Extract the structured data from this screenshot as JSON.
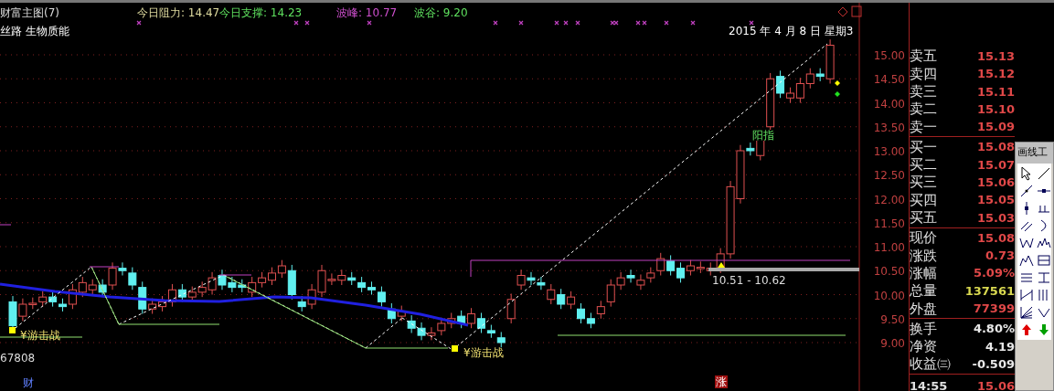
{
  "chart": {
    "title": "财富主图(7)",
    "concepts": "丝路 生物质能",
    "date": "2015 年 4 月 8 日 星期3",
    "indicators": [
      {
        "label": "今日阻力: 14.47",
        "color": "#e0dca0"
      },
      {
        "label": "今日支撑: 14.23",
        "color": "#5ee05e"
      },
      {
        "label": "波峰: 10.77",
        "color": "#d050d0"
      },
      {
        "label": "波谷: 9.20",
        "color": "#5ee05e"
      }
    ],
    "annotations": [
      {
        "kind": "signal",
        "text": "¥游击战"
      },
      {
        "kind": "signal",
        "text": "¥游击战"
      },
      {
        "kind": "pattern",
        "text": "阳指"
      },
      {
        "kind": "range",
        "text": "10.51 - 10.62"
      },
      {
        "kind": "volume",
        "text": "67808"
      },
      {
        "kind": "tag",
        "text": "财"
      },
      {
        "kind": "flag",
        "text": "涨"
      }
    ],
    "y_axis_labels": [
      "15.00",
      "14.50",
      "14.00",
      "13.50",
      "13.00",
      "12.50",
      "12.00",
      "11.50",
      "11.00",
      "10.50",
      "10.00",
      "9.50",
      "9.00"
    ]
  },
  "quotes": [
    [
      {
        "label": "卖五",
        "value": "15.13",
        "kind": "price"
      },
      {
        "label": "卖四",
        "value": "15.12",
        "kind": "price"
      },
      {
        "label": "卖三",
        "value": "15.11",
        "kind": "price"
      },
      {
        "label": "卖二",
        "value": "15.10",
        "kind": "price"
      },
      {
        "label": "卖一",
        "value": "15.09",
        "kind": "price"
      }
    ],
    [
      {
        "label": "买一",
        "value": "15.08",
        "kind": "price"
      },
      {
        "label": "买二",
        "value": "15.07",
        "kind": "price"
      },
      {
        "label": "买三",
        "value": "15.06",
        "kind": "price"
      },
      {
        "label": "买四",
        "value": "15.05",
        "kind": "price"
      },
      {
        "label": "买五",
        "value": "15.03",
        "kind": "price"
      }
    ],
    [
      {
        "label": "现价",
        "value": "15.08",
        "kind": "price"
      },
      {
        "label": "涨跌",
        "value": "0.73",
        "kind": "price"
      },
      {
        "label": "涨幅",
        "value": "5.09%",
        "kind": "price"
      },
      {
        "label": "总量",
        "value": "137561",
        "kind": "volume"
      },
      {
        "label": "外盘",
        "value": "77399",
        "kind": "price"
      }
    ],
    [
      {
        "label": "换手",
        "value": "4.80%",
        "kind": "plain"
      },
      {
        "label": "净资",
        "value": "4.19",
        "kind": "plain"
      },
      {
        "label": "收益㈢",
        "value": "-0.509",
        "kind": "plain"
      }
    ]
  ],
  "ticks": [
    {
      "time": "14:55",
      "price": "15.06"
    }
  ],
  "tool_palette": {
    "title": "画线工"
  }
}
